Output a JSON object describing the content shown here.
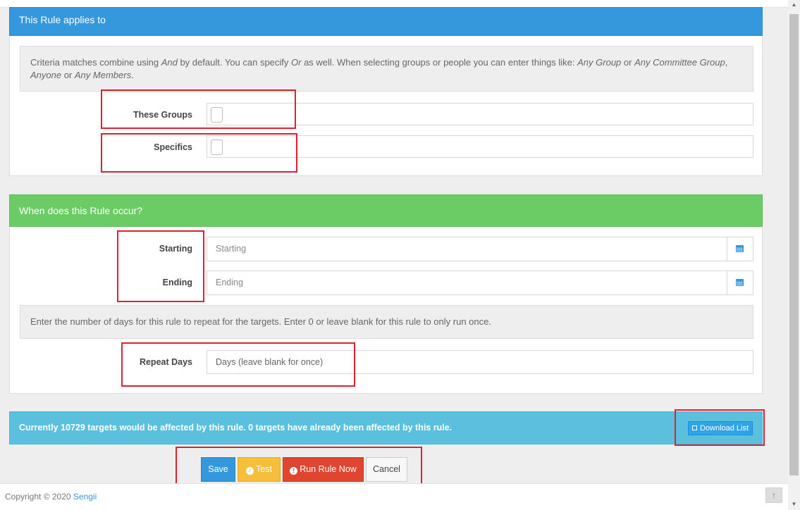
{
  "applies_panel": {
    "title": "This Rule applies to",
    "note_parts": [
      "Criteria matches combine using ",
      "And",
      " by default. You can specify ",
      "Or",
      " as well. When selecting groups or people you can enter things like: ",
      "Any Group",
      " or ",
      "Any Committee Group",
      ", ",
      "Anyone",
      " or ",
      "Any Members",
      "."
    ],
    "groups_label": "These Groups",
    "specifics_label": "Specifics"
  },
  "occur_panel": {
    "title": "When does this Rule occur?",
    "starting_label": "Starting",
    "starting_placeholder": "Starting",
    "ending_label": "Ending",
    "ending_placeholder": "Ending",
    "repeat_note": "Enter the number of days for this rule to repeat for the targets. Enter 0 or leave blank for this rule to only run once.",
    "repeat_label": "Repeat Days",
    "repeat_placeholder": "Days (leave blank for once)"
  },
  "targets": {
    "prefix": "Currently ",
    "count": "10729",
    "middle": " targets would be affected by this rule. ",
    "affected": "0",
    "suffix": " targets have already been affected by this rule.",
    "download_label": "Download List"
  },
  "actions": {
    "save": "Save",
    "test": "Test",
    "run": "Run Rule Now",
    "cancel": "Cancel"
  },
  "footer": {
    "copyright": "Copyright © 2020 ",
    "company": "Sengii"
  },
  "colors": {
    "primary": "#3598dc",
    "success": "#6bcc65",
    "info": "#5bc0de",
    "warning": "#f5be3b",
    "danger": "#e0462f",
    "annotation": "#e0202e"
  }
}
